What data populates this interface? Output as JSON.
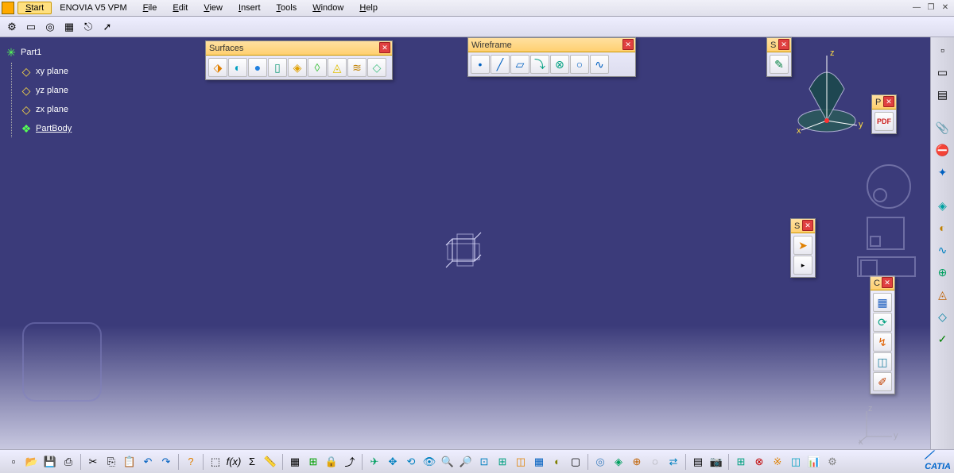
{
  "menu": {
    "items": [
      "Start",
      "ENOVIA V5 VPM",
      "File",
      "Edit",
      "View",
      "Insert",
      "Tools",
      "Window",
      "Help"
    ],
    "highlighted": 0
  },
  "toolrow_icons": [
    "gear",
    "sheet",
    "target",
    "grid",
    "link",
    "arrow"
  ],
  "tree": {
    "root": "Part1",
    "children": [
      {
        "label": "xy plane",
        "type": "plane"
      },
      {
        "label": "yz plane",
        "type": "plane"
      },
      {
        "label": "zx plane",
        "type": "plane"
      },
      {
        "label": "PartBody",
        "type": "body"
      }
    ]
  },
  "panels": {
    "surfaces": {
      "title": "Surfaces",
      "tools": [
        "extrude",
        "revolve",
        "sphere",
        "cylinder",
        "offset",
        "sweep",
        "fill",
        "loft",
        "blend",
        "net"
      ]
    },
    "wireframe": {
      "title": "Wireframe",
      "tools": [
        "point",
        "line",
        "plane",
        "project",
        "intersect",
        "circle",
        "curve"
      ]
    },
    "sketch": {
      "title": "S",
      "tools": [
        "sketch"
      ]
    },
    "pdf": {
      "title": "P",
      "tools": [
        "pdf"
      ]
    },
    "select": {
      "title": "S",
      "tools": [
        "arrow",
        "more"
      ]
    },
    "constraint": {
      "title": "C",
      "tools": [
        "view",
        "grid",
        "autofit",
        "wire",
        "style",
        "paint"
      ]
    }
  },
  "rightbar_icons": [
    "doc",
    "folder",
    "cut",
    "attach",
    "stop",
    "axes",
    "cube",
    "shade",
    "curve",
    "join",
    "surf",
    "surf2",
    "check",
    "material"
  ],
  "bottombar_icons": [
    "new",
    "open",
    "save",
    "print",
    "cut",
    "copy",
    "paste",
    "undo",
    "redo",
    "help",
    "select",
    "fx",
    "sigma",
    "ruler",
    "table",
    "tree",
    "lock",
    "exit",
    "plane",
    "move",
    "rotate",
    "look",
    "zoomin",
    "zoomout",
    "fit",
    "normal",
    "iso",
    "multi",
    "shade",
    "wire",
    "hlr",
    "mat",
    "pick",
    "hide",
    "swap",
    "layer",
    "cam",
    "grid2",
    "dim",
    "pattern",
    "color",
    "graph",
    "opt"
  ],
  "compass_labels": {
    "z": "z",
    "y": "y",
    "x": "x"
  },
  "brand": "CATIA"
}
